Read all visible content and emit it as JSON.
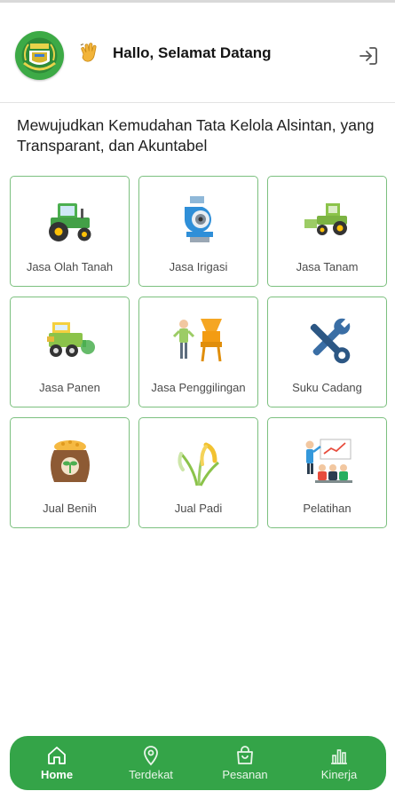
{
  "header": {
    "greeting": "Hallo, Selamat Datang",
    "logo_icon": "regional-emblem-logo",
    "wave_icon": "waving-hand-icon",
    "logout_icon": "logout-icon"
  },
  "tagline": "Mewujudkan Kemudahan Tata Kelola Alsintan, yang Transparant, dan Akuntabel",
  "services": [
    {
      "label": "Jasa Olah Tanah",
      "icon": "tractor-icon"
    },
    {
      "label": "Jasa Irigasi",
      "icon": "water-pump-icon"
    },
    {
      "label": "Jasa Tanam",
      "icon": "rice-planter-icon"
    },
    {
      "label": "Jasa Panen",
      "icon": "combine-harvester-icon"
    },
    {
      "label": "Jasa Penggilingan",
      "icon": "rice-mill-icon"
    },
    {
      "label": "Suku Cadang",
      "icon": "tools-icon"
    },
    {
      "label": "Jual Benih",
      "icon": "seed-sack-icon"
    },
    {
      "label": "Jual Padi",
      "icon": "rice-plant-icon"
    },
    {
      "label": "Pelatihan",
      "icon": "training-icon"
    }
  ],
  "bottom_nav": [
    {
      "label": "Home",
      "icon": "home-icon",
      "active": true
    },
    {
      "label": "Terdekat",
      "icon": "location-pin-icon",
      "active": false
    },
    {
      "label": "Pesanan",
      "icon": "shopping-bag-icon",
      "active": false
    },
    {
      "label": "Kinerja",
      "icon": "bar-chart-icon",
      "active": false
    }
  ],
  "colors": {
    "accent_green": "#34a448",
    "card_border": "#7cc07f"
  }
}
